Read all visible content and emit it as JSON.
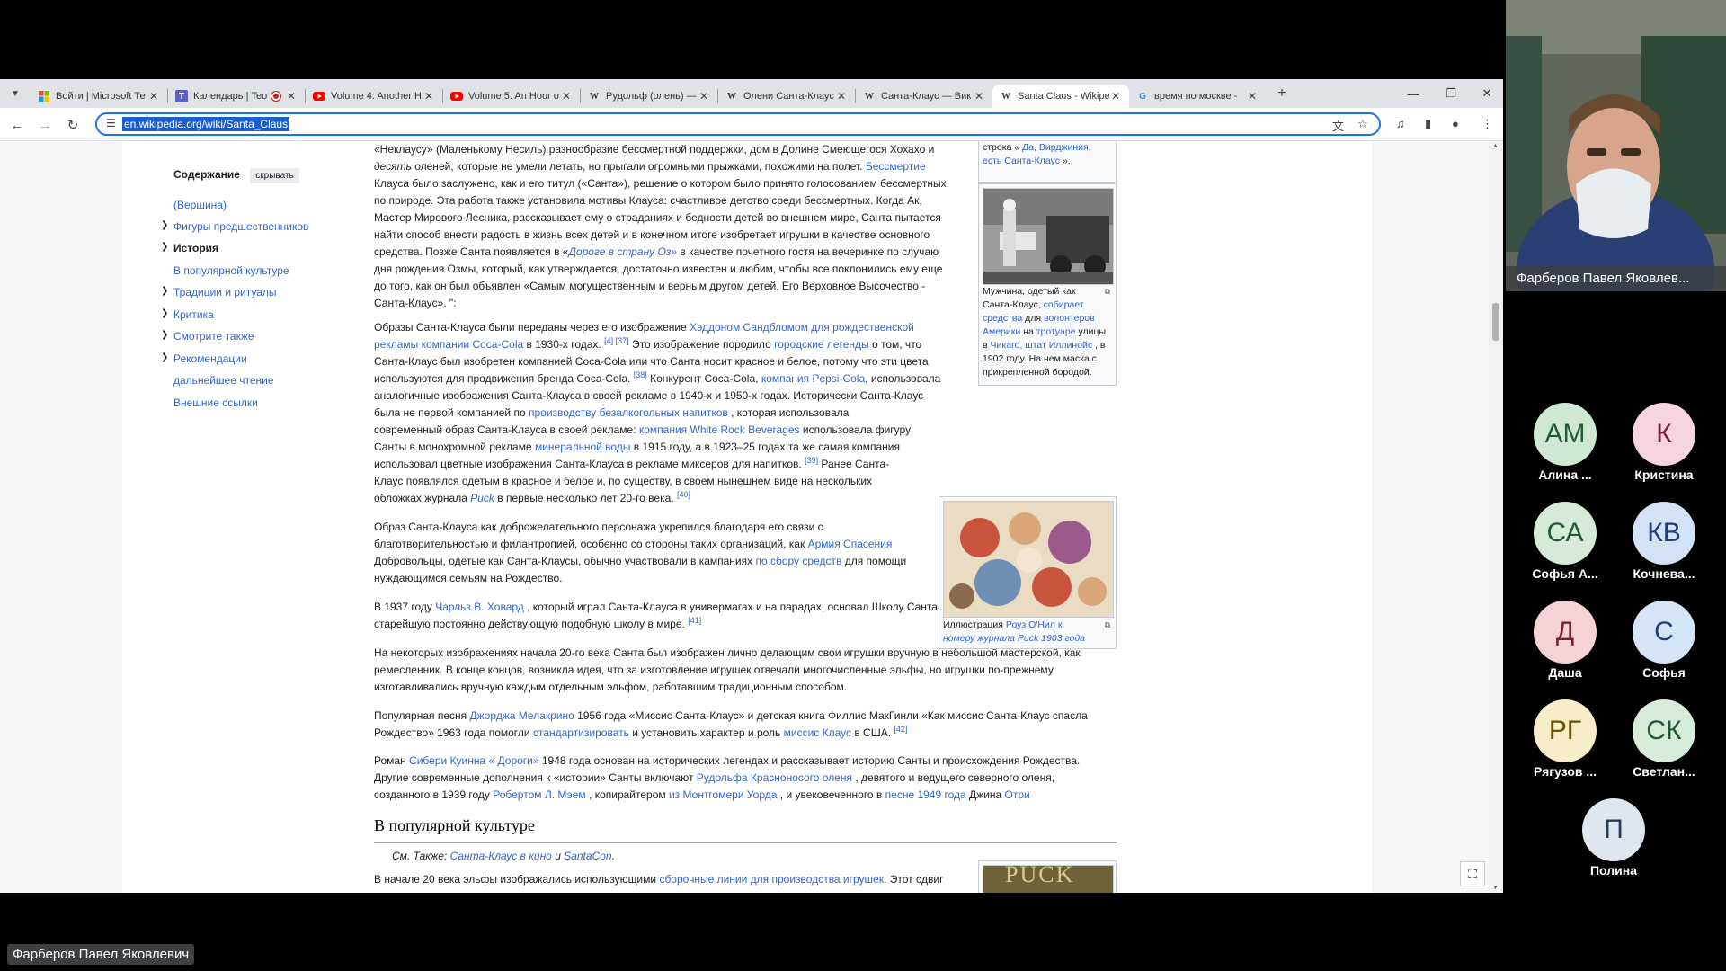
{
  "browser": {
    "tabs": [
      {
        "title": "Войти | Microsoft Те",
        "icon": "microsoft-icon",
        "color": "#f25022"
      },
      {
        "title": "Календарь | Teo",
        "icon": "teams-icon",
        "color": "#5b5fc7",
        "recording": true
      },
      {
        "title": "Volume 4: Another H",
        "icon": "youtube-icon",
        "color": "#ff0000"
      },
      {
        "title": "Volume 5: An Hour o",
        "icon": "youtube-icon",
        "color": "#ff0000"
      },
      {
        "title": "Рудольф (олень) — ",
        "icon": "wikipedia-icon",
        "color": "#202122"
      },
      {
        "title": "Олени Санта-Клаус",
        "icon": "wikipedia-icon",
        "color": "#202122"
      },
      {
        "title": "Санта-Клаус — Вик",
        "icon": "wikipedia-icon",
        "color": "#202122"
      },
      {
        "title": "Santa Claus - Wikipe",
        "icon": "wikipedia-icon",
        "color": "#202122",
        "active": true
      },
      {
        "title": "время по москве - ",
        "icon": "google-icon",
        "color": "#4285f4"
      }
    ],
    "url": "en.wikipedia.org/wiki/Santa_Claus"
  },
  "toc": {
    "title": "Содержание",
    "hide_label": "скрывать",
    "items": [
      {
        "label": "(Вершина)",
        "chevron": false
      },
      {
        "label": "Фигуры предшественников",
        "chevron": true
      },
      {
        "label": "История",
        "chevron": true,
        "current": true
      },
      {
        "label": "В популярной культуре",
        "chevron": false
      },
      {
        "label": "Традиции и ритуалы",
        "chevron": true
      },
      {
        "label": "Критика",
        "chevron": true
      },
      {
        "label": "Смотрите также",
        "chevron": true
      },
      {
        "label": "Рекомендации",
        "chevron": true
      },
      {
        "label": "дальнейшее чтение",
        "chevron": false
      },
      {
        "label": "Внешние ссылки",
        "chevron": false
      }
    ]
  },
  "article": {
    "p1": {
      "l1": "«Неклаусу» (Маленькому Несиль) разнообразие бессмертной поддержки, дом в Долине Смеющегося Хохахо и",
      "l2a": "десять",
      "l2b": " оленей, которые не умели летать, но прыгали огромными прыжками, похожими на полет.",
      "l2link": "Бессмертие",
      "l3": "Клауса было заслужено, как и его титул («Санта»), решение о котором было принято голосованием бессмертных",
      "l4": "по природе. Эта работа также установила мотивы Клауса: счастливое детство среди бессмертных. Когда Ак,",
      "l5": "Мастер Мирового Лесника, рассказывает ему о страданиях и бедности детей во внешнем мире, Санта пытается",
      "l6": "найти способ внести радость в жизнь всех детей и в конечном итоге изобретает игрушки в качестве основного",
      "l7a": "средства. Позже Санта появляется в «",
      "l7link": "Дороге в страну Оз»",
      "l7b": " в качестве почетного гостя на вечеринке по случаю",
      "l8": "дня рождения Озмы, который, как утверждается, достаточно известен и любим, чтобы все поклонились ему еще",
      "l9": "до того, как он был объявлен «Самым могущественным и верным другом детей, Его Верховное Высочество -",
      "l10": "Санта-Клаус». \":"
    },
    "p2": {
      "l1a": "Образы Санта-Клауса были переданы через его изображение ",
      "l1link": "Хэддоном Сандбломом для рождественской",
      "l2link": "рекламы компании Coca-Cola",
      "l2b": " в 1930-х годах.",
      "l2sup": "[4] [37]",
      "l2c": " Это изображение породило ",
      "l2link2": "городские легенды",
      "l2d": " о том, что",
      "l3": "Санта-Клаус был изобретен компанией Coca-Cola или что Санта носит красное и белое, потому что эти цвета",
      "l4a": "используются для продвижения бренда Coca-Cola.",
      "l4sup": "[38]",
      "l4b": " Конкурент Coca-Cola, ",
      "l4link": "компания Pepsi-Cola",
      "l4c": ", использовала",
      "l5": "аналогичные изображения Санта-Клауса в своей рекламе в 1940-х и 1950-х годах. Исторически Санта-Клаус",
      "l6a": "была не первой компанией по ",
      "l6link": "производству безалкогольных напитков",
      "l6b": " , которая использовала",
      "l7a": "современный образ Санта-Клауса в своей рекламе: ",
      "l7link": "компания White Rock Beverages",
      "l7b": " использовала фигуру",
      "l8a": "Санты в монохромной рекламе ",
      "l8link": "минеральной воды",
      "l8b": " в 1915 году, а в 1923–25 годах та же самая компания",
      "l9a": "использовал цветные изображения Санта-Клауса в рекламе миксеров для напитков.",
      "l9sup": "[39]",
      "l9b": " Ранее Санта-",
      "l10": "Клаус появлялся одетым в красное и белое и, по существу, в своем нынешнем виде на нескольких",
      "l11a": "обложках журнала ",
      "l11link": "Puck",
      "l11b": " в первые несколько лет 20-го века.",
      "l11sup": "[40]"
    },
    "p3": {
      "l1": "Образ Санта-Клауса как доброжелательного персонажа укрепился благодаря его связи с",
      "l2a": "благотворительностью и филантропией, особенно со стороны таких организаций, как ",
      "l2link": "Армия Спасения",
      "l3a": "Добровольцы, одетые как Санта-Клаусы, обычно участвовали в кампаниях ",
      "l3link": "по сбору средств",
      "l3b": " для помощи",
      "l4": "нуждающимся семьям на Рождество."
    },
    "p4": {
      "l1a": "В 1937 году ",
      "l1link": "Чарльз В. Ховард",
      "l1b": " , который играл Санта-Клауса в универмагах и на парадах, основал Школу Санта-Клауса Чарльза В. Ховарда,",
      "l2a": "старейшую постоянно действующую подобную школу в мире.",
      "l2sup": "[41]"
    },
    "p5": {
      "l1": "На некоторых изображениях начала 20-го века Санта был изображен лично делающим свои игрушки вручную в небольшой мастерской, как",
      "l2": "ремесленник. В конце концов, возникла идея, что за изготовление игрушек отвечали многочисленные эльфы, но игрушки по-прежнему",
      "l3": "изготавливались вручную каждым отдельным эльфом, работавшим традиционным способом."
    },
    "p6": {
      "l1a": "Популярная песня ",
      "l1link": "Джорджа Мелакрино",
      "l1b": " 1956 года «Миссис Санта-Клаус» и детская книга Филлис МакГинли «Как миссис Санта-Клаус спасла",
      "l2a": "Рождество» 1963 года помогли ",
      "l2link": "стандартизировать",
      "l2b": " и установить характер и роль ",
      "l2link2": "миссис Клаус",
      "l2c": " в США.",
      "l2sup": "[42]"
    },
    "p7": {
      "l1a": "Роман ",
      "l1link": "Сибери Куинна « Дороги»",
      "l1b": " 1948 года основан на исторических легендах и рассказывает историю Санты и происхождения Рождества.",
      "l2a": "Другие современные дополнения к «истории» Санты включают ",
      "l2link": "Рудольфа Красноносого оленя",
      "l2b": " , девятого и ведущего северного оленя,",
      "l3a": "созданного в 1939 году ",
      "l3link": "Робертом Л. Мэем",
      "l3b": " , копирайтером ",
      "l3link2": "из Монтгомери Уорда",
      "l3c": " , и увековеченного в ",
      "l3link3": "песне 1949 года",
      "l3d": " Джина ",
      "l3link4": "Отри"
    },
    "section2_title": "В популярной культуре",
    "see_also": {
      "prefix": "См. Также: ",
      "link1": "Санта-Клаус в кино",
      "mid": " и ",
      "link2": "SantaCon",
      "suffix": "."
    },
    "p8": {
      "l1a": "В начале 20 века эльфы изображались использующими ",
      "l1link": "сборочные линии для производства игрушек",
      "l1b": ". Этот сдвиг"
    }
  },
  "thumbs": {
    "top_caption_l1a": "строка « ",
    "top_caption_link": "Да, Вирджиния,",
    "top_caption_l2link": "есть Санта-Клаус",
    "top_caption_l2b": " ».",
    "photo_caption": {
      "l1": "Мужчина, одетый как",
      "l2a": "Санта-Клаус, ",
      "l2link": "собирает",
      "l3link": "средства",
      "l3b": " для ",
      "l3link2": "волонтеров",
      "l4link": "Америки",
      "l4b": " на ",
      "l4link2": "тротуаре",
      "l4c": " улицы",
      "l5a": "в ",
      "l5link": "Чикаго, штат Иллинойс",
      "l5b": " , в",
      "l6": "1902 году. На нем маска с",
      "l7": "прикрепленной бородой."
    },
    "puck_caption": {
      "l1a": "Иллюстрация ",
      "l1link": "Роуз О'Нил к",
      "l2link": "номеру журнала Puck 1903 года"
    },
    "puck_logo": "PUCK"
  },
  "call": {
    "speaker_name": "Фарберов Павел Яковлев...",
    "presenter_name": "Фарберов Павел Яковлевич",
    "participants": [
      {
        "initials": "АМ",
        "name": "Алина ...",
        "bg": "#cfe8d4",
        "fg": "#1e5b30"
      },
      {
        "initials": "К",
        "name": "Кристина",
        "bg": "#f6d4de",
        "fg": "#7b1f3c"
      },
      {
        "initials": "СА",
        "name": "Софья А...",
        "bg": "#d5ead8",
        "fg": "#1e5b30"
      },
      {
        "initials": "КВ",
        "name": "Кочнева...",
        "bg": "#d4e2f5",
        "fg": "#1d3f78"
      },
      {
        "initials": "Д",
        "name": "Даша",
        "bg": "#f4d2d6",
        "fg": "#7a1f2b"
      },
      {
        "initials": "С",
        "name": "Софья",
        "bg": "#d5e4f6",
        "fg": "#1d3f78"
      },
      {
        "initials": "РГ",
        "name": "Рягузов ...",
        "bg": "#f7edc9",
        "fg": "#6a5000"
      },
      {
        "initials": "СК",
        "name": "Светлан...",
        "bg": "#d7ebdb",
        "fg": "#1e5b30"
      },
      {
        "initials": "П",
        "name": "Полина",
        "bg": "#dfe6ee",
        "fg": "#283d55"
      }
    ]
  }
}
